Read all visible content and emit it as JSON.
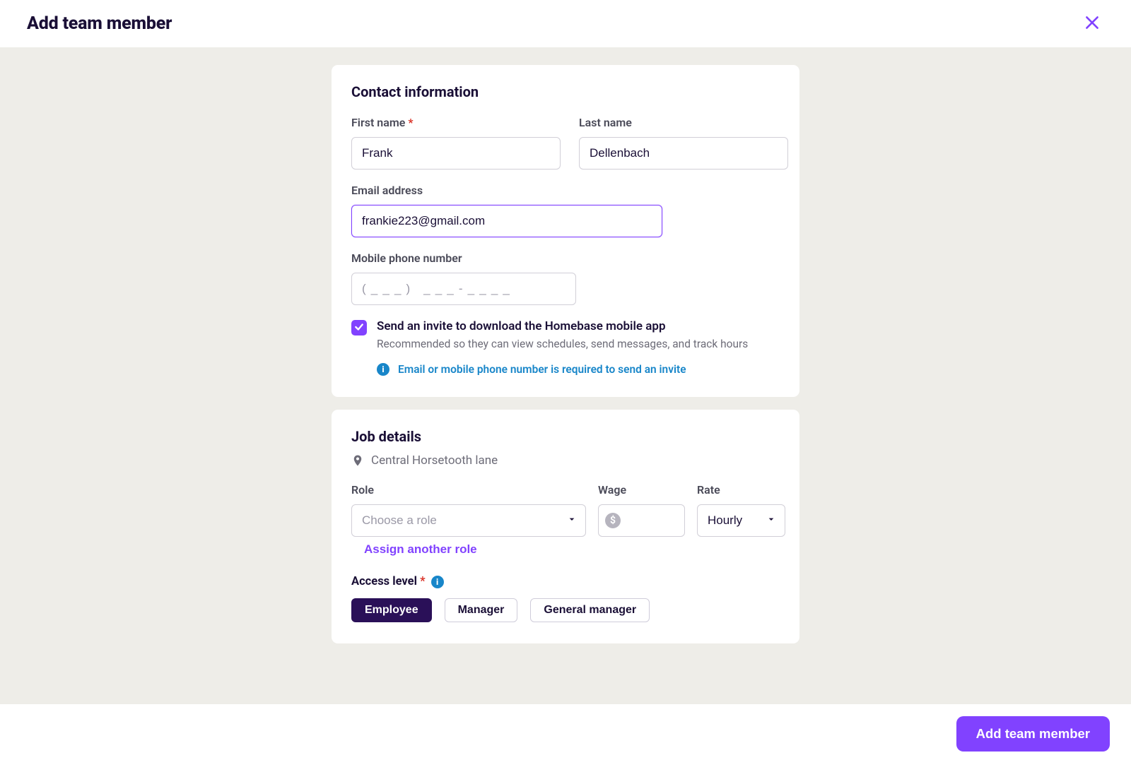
{
  "header": {
    "title": "Add team member"
  },
  "contact": {
    "section_title": "Contact information",
    "first_name_label": "First name",
    "first_name_value": "Frank",
    "last_name_label": "Last name",
    "last_name_value": "Dellenbach",
    "email_label": "Email address",
    "email_value": "frankie223@gmail.com",
    "phone_label": "Mobile phone number",
    "phone_placeholder": "( _ _ _ )   _ _ _ - _ _ _ _",
    "phone_value": "",
    "invite_checked": true,
    "invite_label": "Send an invite to download the Homebase mobile app",
    "invite_hint": "Recommended so they can view schedules, send messages, and track hours",
    "invite_requirement": "Email or mobile phone number is required to send an invite"
  },
  "job": {
    "section_title": "Job details",
    "location": "Central Horsetooth lane",
    "role_label": "Role",
    "role_placeholder": "Choose a role",
    "wage_label": "Wage",
    "wage_value": "",
    "rate_label": "Rate",
    "rate_value": "Hourly",
    "assign_another": "Assign another role",
    "access_label": "Access level",
    "access_options": {
      "employee": "Employee",
      "manager": "Manager",
      "general_manager": "General manager"
    },
    "access_selected": "Employee"
  },
  "footer": {
    "submit": "Add team member"
  }
}
